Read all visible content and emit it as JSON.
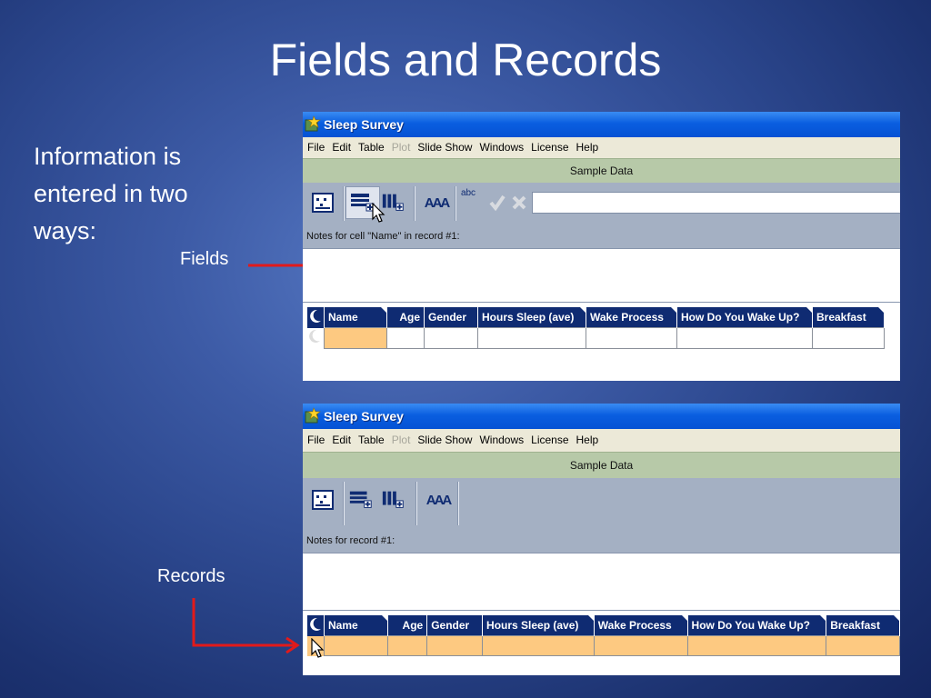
{
  "slide": {
    "title": "Fields and Records",
    "bullet": "Information is entered in two ways:",
    "callout_fields": "Fields",
    "callout_records": "Records"
  },
  "colors": {
    "background": "#2b468c",
    "arrow": "#e21a1a",
    "header_row": "#0f2b72",
    "highlight": "#fdc981"
  },
  "window1": {
    "title": "Sleep Survey",
    "menu": [
      "File",
      "Edit",
      "Table",
      "Plot",
      "Slide Show",
      "Windows",
      "License",
      "Help"
    ],
    "dataset": "Sample Data",
    "toolbar_icons": [
      "card-view-icon",
      "add-field-icon",
      "add-record-icon",
      "font-size-icon",
      "spell-abc-icon",
      "check-icon",
      "cancel-icon"
    ],
    "spell_label": "abc",
    "font_label": "AAA",
    "notes_label": "Notes for cell \"Name\" in record #1:",
    "columns": [
      "Name",
      "Age",
      "Gender",
      "Hours Sleep (ave)",
      "Wake Process",
      "How Do You Wake Up?",
      "Breakfast"
    ]
  },
  "window2": {
    "title": "Sleep Survey",
    "menu": [
      "File",
      "Edit",
      "Table",
      "Plot",
      "Slide Show",
      "Windows",
      "License",
      "Help"
    ],
    "dataset": "Sample Data",
    "font_label": "AAA",
    "notes_label": "Notes for record #1:",
    "columns": [
      "Name",
      "Age",
      "Gender",
      "Hours Sleep (ave)",
      "Wake Process",
      "How Do You Wake Up?",
      "Breakfast"
    ]
  }
}
